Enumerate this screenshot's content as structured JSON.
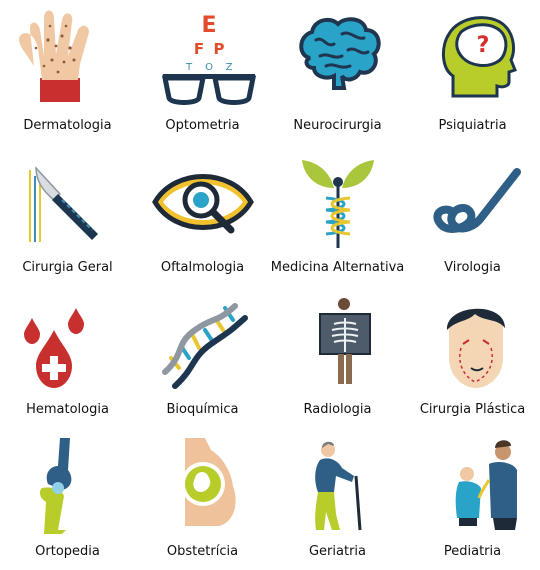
{
  "specialties": [
    {
      "label": "Dermatologia",
      "icon": "hand-icon"
    },
    {
      "label": "Optometria",
      "icon": "eye-chart-glasses-icon",
      "chart_letters": [
        "E",
        "F",
        "P",
        "T",
        "O",
        "Z"
      ]
    },
    {
      "label": "Neurocirurgia",
      "icon": "brain-icon"
    },
    {
      "label": "Psiquiatria",
      "icon": "head-question-icon",
      "mark": "?"
    },
    {
      "label": "Cirurgia Geral",
      "icon": "scalpel-icon"
    },
    {
      "label": "Oftalmologia",
      "icon": "eye-magnifier-icon"
    },
    {
      "label": "Medicina Alternativa",
      "icon": "caduceus-leaves-icon"
    },
    {
      "label": "Virologia",
      "icon": "virus-icon"
    },
    {
      "label": "Hematologia",
      "icon": "blood-drops-icon"
    },
    {
      "label": "Bioquímica",
      "icon": "dna-icon"
    },
    {
      "label": "Radiologia",
      "icon": "xray-icon"
    },
    {
      "label": "Cirurgia Plástica",
      "icon": "face-surgery-icon"
    },
    {
      "label": "Ortopedia",
      "icon": "knee-joint-icon"
    },
    {
      "label": "Obstetrícia",
      "icon": "pregnancy-icon"
    },
    {
      "label": "Geriatria",
      "icon": "elderly-person-icon"
    },
    {
      "label": "Pediatria",
      "icon": "doctor-child-icon"
    }
  ]
}
